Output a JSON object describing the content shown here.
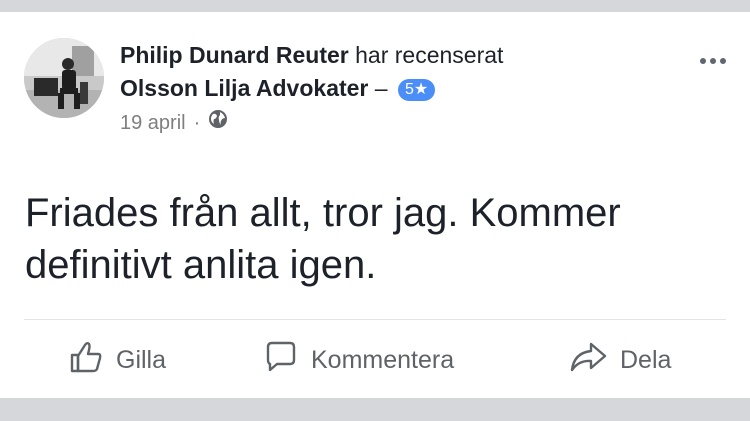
{
  "post": {
    "author": "Philip Dunard Reuter",
    "action": "har recenserat",
    "page": "Olsson Lilja Advokater",
    "dash": "–",
    "rating": "5★",
    "date": "19 april",
    "separator": "·",
    "privacy_icon": "globe-icon",
    "more_icon": "more-dots-icon",
    "review_text": "Friades från allt, tror jag. Kommer definitivt anlita igen."
  },
  "actions": {
    "like": {
      "label": "Gilla",
      "icon": "thumbs-up-icon"
    },
    "comment": {
      "label": "Kommentera",
      "icon": "comment-icon"
    },
    "share": {
      "label": "Dela",
      "icon": "share-arrow-icon"
    }
  },
  "colors": {
    "badge": "#4c8ef7",
    "action_text": "#5f6368",
    "meta_text": "#7f7f7f",
    "background_band": "#d6d7da"
  }
}
